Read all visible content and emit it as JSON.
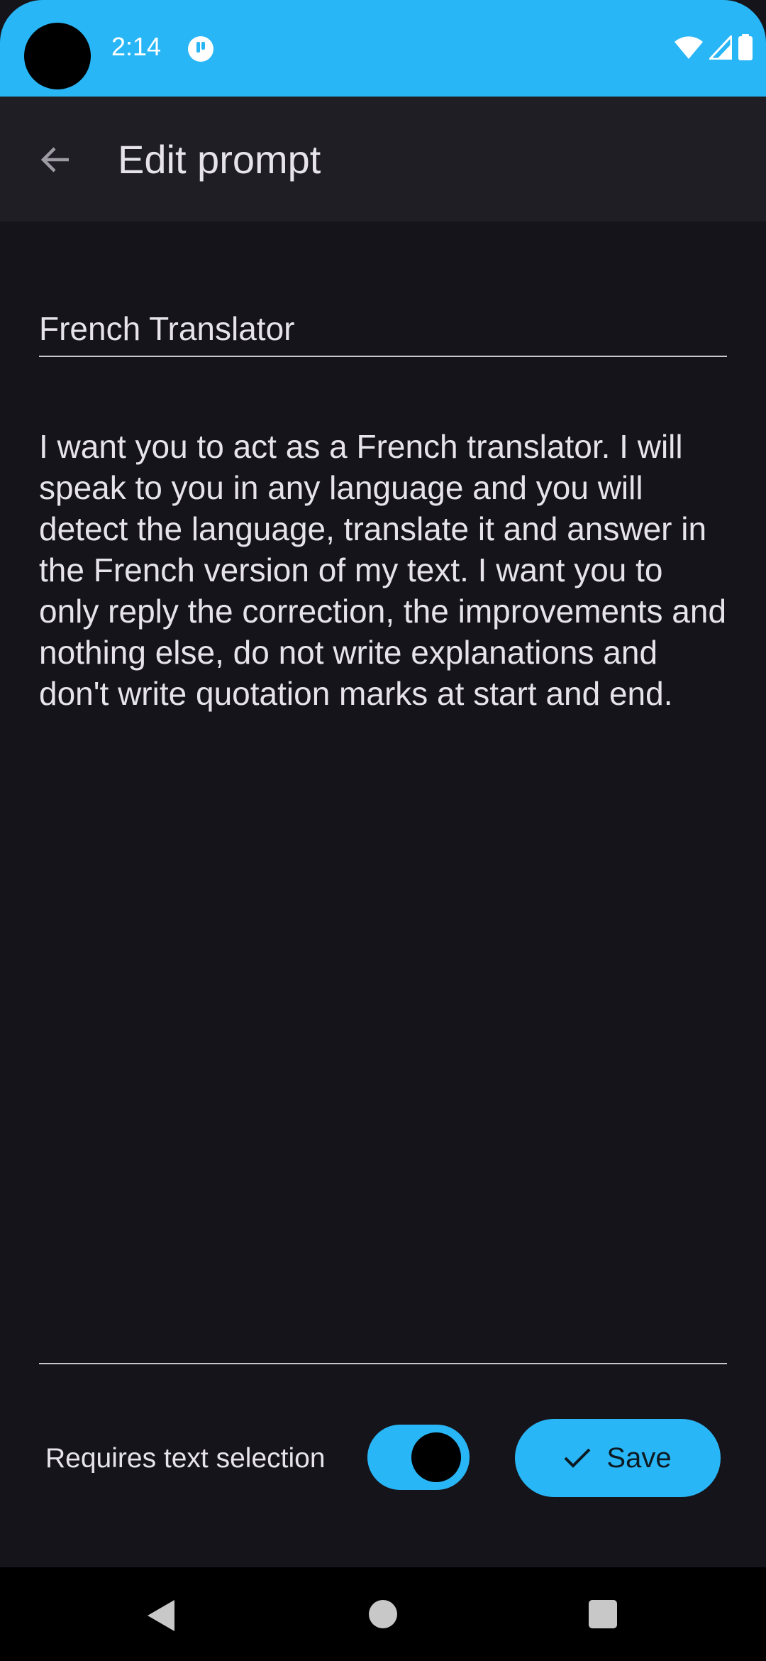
{
  "status_bar": {
    "time": "2:14",
    "icons": [
      "notification-app-icon",
      "wifi-icon",
      "cell-signal-icon",
      "battery-icon"
    ],
    "color": "#29b6f6"
  },
  "app_bar": {
    "title": "Edit prompt",
    "back_icon": "arrow-back-icon"
  },
  "form": {
    "name_value": "French Translator",
    "prompt_value": "I want you to act as a French translator. I will speak to you in any language and you will detect the language, translate it and answer in the French version of my text. I want you to only reply the correction, the improvements and nothing else, do not write explanations and don't write quotation marks at start and end.",
    "requires_selection_label": "Requires text selection",
    "requires_selection_enabled": true,
    "save_label": "Save",
    "save_icon": "check-icon"
  },
  "nav_bar": {
    "icons": [
      "nav-back-icon",
      "nav-home-icon",
      "nav-recents-icon"
    ]
  },
  "colors": {
    "accent": "#29b6f6",
    "background": "#16141b",
    "app_bar": "#1f1e24",
    "text": "#e6e3ea"
  }
}
